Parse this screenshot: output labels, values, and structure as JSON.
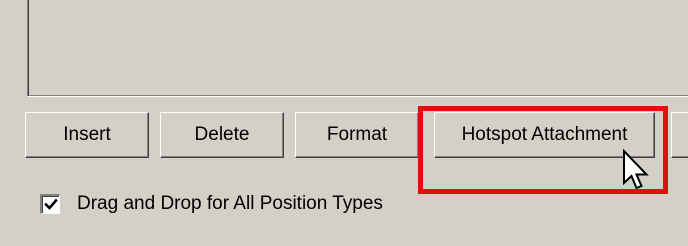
{
  "buttons": {
    "insert": "Insert",
    "delete": "Delete",
    "format": "Format",
    "hotspot_attachment": "Hotspot Attachment"
  },
  "checkbox": {
    "label": "Drag and Drop for All Position Types",
    "checked": true
  },
  "colors": {
    "background": "#d4d0c8",
    "highlight": "#e01010"
  },
  "icons": {
    "cursor": "arrow-cursor-icon",
    "check": "checkmark-icon"
  }
}
